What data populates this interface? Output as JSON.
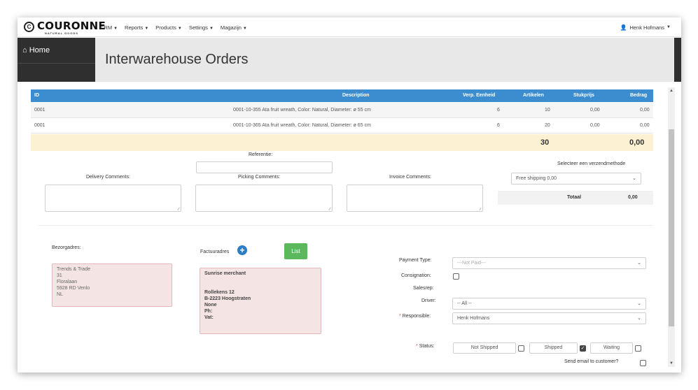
{
  "brand": {
    "name": "COURONNE",
    "tagline": "NATURAL GOODS",
    "mark": "C"
  },
  "nav": {
    "items": [
      {
        "label": "CRM"
      },
      {
        "label": "Reports"
      },
      {
        "label": "Products"
      },
      {
        "label": "Settings"
      },
      {
        "label": "Magazijn"
      }
    ],
    "user": "Henk Hofmans"
  },
  "sidebar": {
    "home_label": "Home"
  },
  "page": {
    "title": "Interwarehouse Orders"
  },
  "table": {
    "headers": {
      "id": "ID",
      "description": "Description",
      "verp": "Verp. Eenheid",
      "artikelen": "Artikelen",
      "stukprijs": "Stukprijs",
      "bedrag": "Bedrag"
    },
    "rows": [
      {
        "id": "0001",
        "description": "0001-10-355 Ata fruit wreath, Color: Natural, Diameter: ø 55 cm",
        "verp": "6",
        "artikelen": "10",
        "stukprijs": "0,00",
        "bedrag": "0,00"
      },
      {
        "id": "0001",
        "description": "0001-10-365 Ata fruit wreath, Color: Natural, Diameter: ø 65 cm",
        "verp": "6",
        "artikelen": "20",
        "stukprijs": "0,00",
        "bedrag": "0,00"
      }
    ],
    "total_artikelen": "30",
    "total_bedrag": "0,00"
  },
  "form": {
    "referentie_label": "Referentie:",
    "referentie_value": "",
    "delivery_comments_label": "Delivery Comments:",
    "picking_comments_label": "Picking Comments:",
    "invoice_comments_label": "Invoice Comments:",
    "shipping_label": "Selecteer een verzendmethode",
    "shipping_value": "Free shipping 0,00",
    "totaal_label": "Totaal",
    "totaal_value": "0,00",
    "bezorgadres_label": "Bezorgadres:",
    "bezorgadres_lines": [
      "Trends & Trade",
      "31",
      "Floralaan",
      "5928 RD Venlo",
      "NL"
    ],
    "factuuradres_label": "Factuuradres",
    "list_button": "List",
    "factuuradres_lines": [
      "Sunrise merchant",
      "",
      "",
      "Rollekens 12",
      "B-2223 Hoogstraten",
      "None",
      "Ph:",
      "Vat:"
    ],
    "payment_type_label": "Payment Type:",
    "payment_type_value": "---Not Paid---",
    "consignation_label": "Consignation:",
    "salesrep_label": "Salesrep:",
    "driver_label": "Driver:",
    "driver_value": "-- All --",
    "responsible_label": "Responsible:",
    "responsible_value": "Henk Hofmans",
    "status_label": "Status:",
    "status_not_shipped": "Not Shipped",
    "status_shipped": "Shipped",
    "status_waiting": "Waiting",
    "send_email_label": "Send email to customer?"
  }
}
